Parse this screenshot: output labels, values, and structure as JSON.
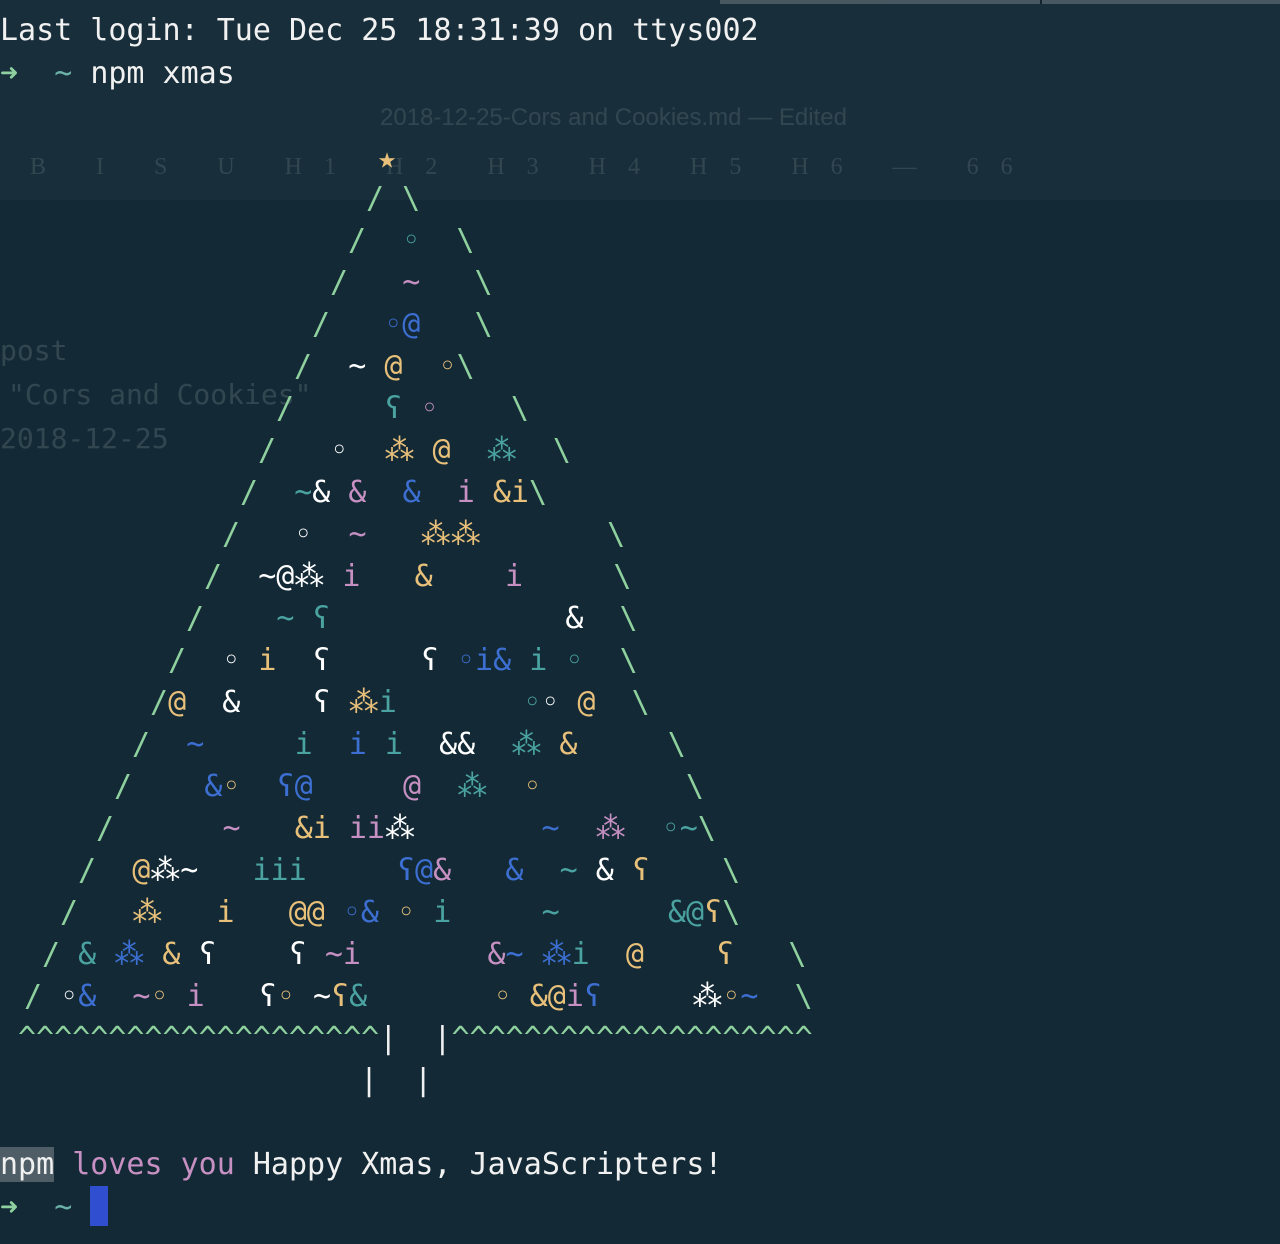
{
  "terminal": {
    "last_login": "Last login: Tue Dec 25 18:31:39 on ttys002",
    "prompt_arrow": "➜",
    "prompt_dir": "~",
    "command": "npm xmas",
    "footer_npm": "npm",
    "footer_loves": "loves you",
    "footer_message": "Happy Xmas, JavaScripters!"
  },
  "background_window": {
    "doc_title": "2018-12-25-Cors and Cookies.md — Edited",
    "toolbar": "B I S U H1 H2 H3 H4 H5 H6 — 66",
    "frontmatter": [
      "post",
      "\"Cors and Cookies\"",
      "2018-12-25"
    ]
  },
  "colors": {
    "background": "#132a36",
    "prompt_arrow": "#8fd19e",
    "tree_edge": "#8fd19e",
    "star": "#e8c07a",
    "ornament_white": "#ffffff",
    "ornament_yellow": "#e8c07a",
    "ornament_pink": "#c790c2",
    "ornament_blue": "#3c6fd1",
    "ornament_teal": "#4aa3a0",
    "cursor": "#2f4fd0"
  },
  "tree": {
    "star": "★",
    "base_left": "^^^^^^^^^^^^^^^^^^^^",
    "base_right": "^^^^^^^^^^^^^^^^^^^^",
    "trunk": "|  |"
  }
}
